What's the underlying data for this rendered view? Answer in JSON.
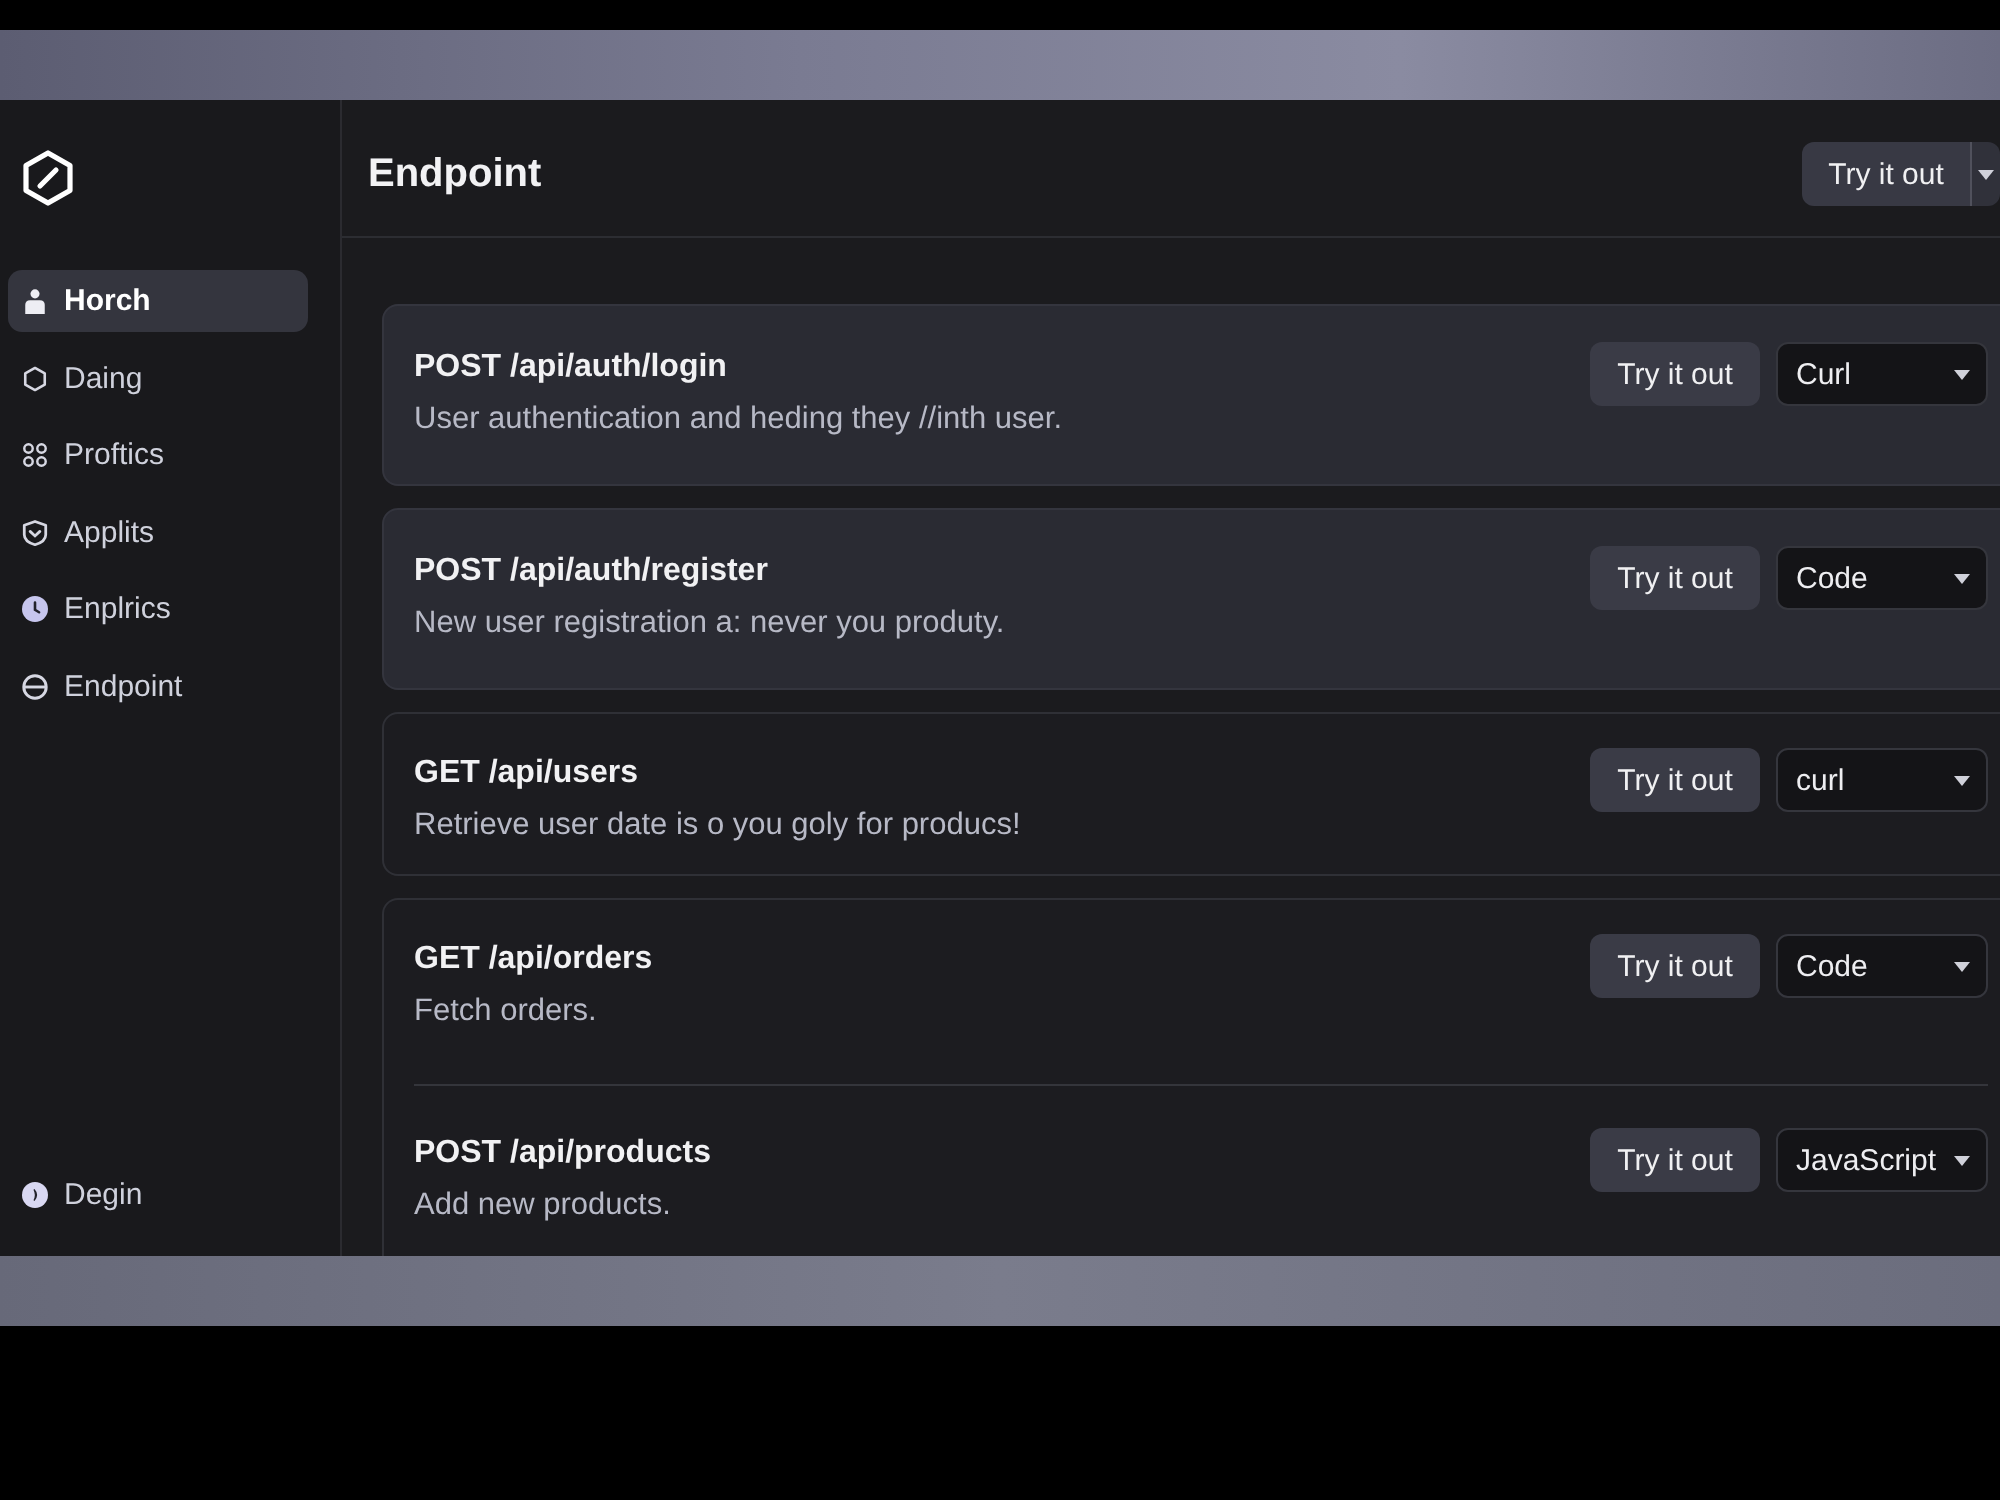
{
  "sidebar": {
    "items": [
      {
        "label": "Horch",
        "selected": true
      },
      {
        "label": "Daing",
        "selected": false
      },
      {
        "label": "Proftics",
        "selected": false
      },
      {
        "label": "Applits",
        "selected": false
      },
      {
        "label": "Enplrics",
        "selected": false
      },
      {
        "label": "Endpoint",
        "selected": false
      }
    ],
    "footer_item": {
      "label": "Degin"
    }
  },
  "header": {
    "title": "Endpoint",
    "action": "Try it out"
  },
  "cards": [
    {
      "kind": "raised",
      "endpoints": [
        {
          "title": "POST /api/auth/login",
          "description": "User authentication and heding they //inth user.",
          "button": "Try it out",
          "format": "Curl"
        }
      ]
    },
    {
      "kind": "raised",
      "endpoints": [
        {
          "title": "POST /api/auth/register",
          "description": "New user registration a: never you produty.",
          "button": "Try it out",
          "format": "Code"
        }
      ]
    },
    {
      "kind": "outlined",
      "endpoints": [
        {
          "title": "GET /api/users",
          "description": "Retrieve user date is o you goly for producs!",
          "button": "Try it out",
          "format": "curl"
        }
      ]
    },
    {
      "kind": "outlined",
      "endpoints": [
        {
          "title": "GET /api/orders",
          "description": "Fetch orders.",
          "button": "Try it out",
          "format": "Code"
        },
        {
          "title": "POST /api/products",
          "description": "Add new products.",
          "button": "Try it out",
          "format": "JavaScript"
        }
      ]
    }
  ]
}
